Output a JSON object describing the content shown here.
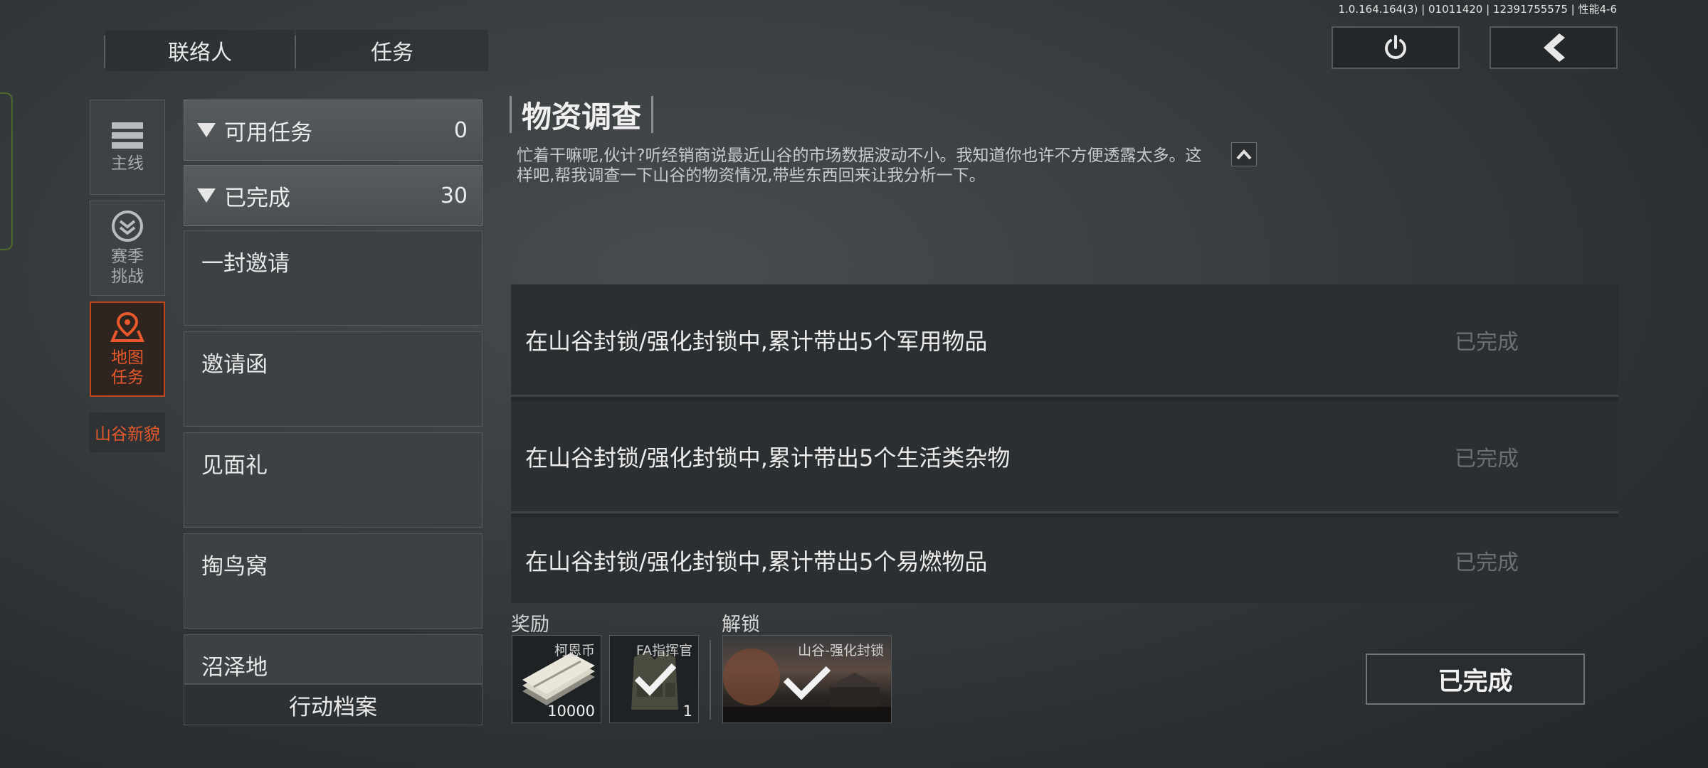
{
  "version": "1.0.164.164(3) | 01011420 | 12391755575 | 性能4-6",
  "top_tabs": [
    "联络人",
    "任务"
  ],
  "top_buttons": {
    "power_icon": "power-icon",
    "back_icon": "chevron-left-icon"
  },
  "categories": [
    {
      "label": "主线",
      "icon": "list-icon"
    },
    {
      "label": "赛季\n挑战",
      "icon": "chevron-badge-icon"
    },
    {
      "label": "地图\n任务",
      "icon": "map-pin-icon"
    }
  ],
  "sub_category": "山谷新貌",
  "task_groups": [
    {
      "label": "可用任务",
      "count": "0"
    },
    {
      "label": "已完成",
      "count": "30"
    }
  ],
  "tasks": [
    "一封邀请",
    "邀请函",
    "见面礼",
    "掏鸟窝",
    "沼泽地"
  ],
  "archive_label": "行动档案",
  "quest": {
    "title": "物资调查",
    "description": "忙着干嘛呢,伙计?听经销商说最近山谷的市场数据波动不小。我知道你也许不方便透露太多。这样吧,帮我调查一下山谷的物资情况,带些东西回来让我分析一下。",
    "objectives": [
      {
        "text": "在山谷封锁/强化封锁中,累计带出5个军用物品",
        "status": "已完成"
      },
      {
        "text": "在山谷封锁/强化封锁中,累计带出5个生活类杂物",
        "status": "已完成"
      },
      {
        "text": "在山谷封锁/强化封锁中,累计带出5个易燃物品",
        "status": "已完成"
      }
    ]
  },
  "rewards_label": "奖励",
  "rewards": [
    {
      "label": "柯恩币",
      "count": "10000"
    },
    {
      "label": "FA指挥官",
      "count": "1"
    }
  ],
  "unlock_label": "解锁",
  "unlock": {
    "label": "山谷-强化封锁"
  },
  "complete_button": "已完成",
  "colors": {
    "accent": "#e8582b",
    "status_done": "#6b6f72"
  }
}
